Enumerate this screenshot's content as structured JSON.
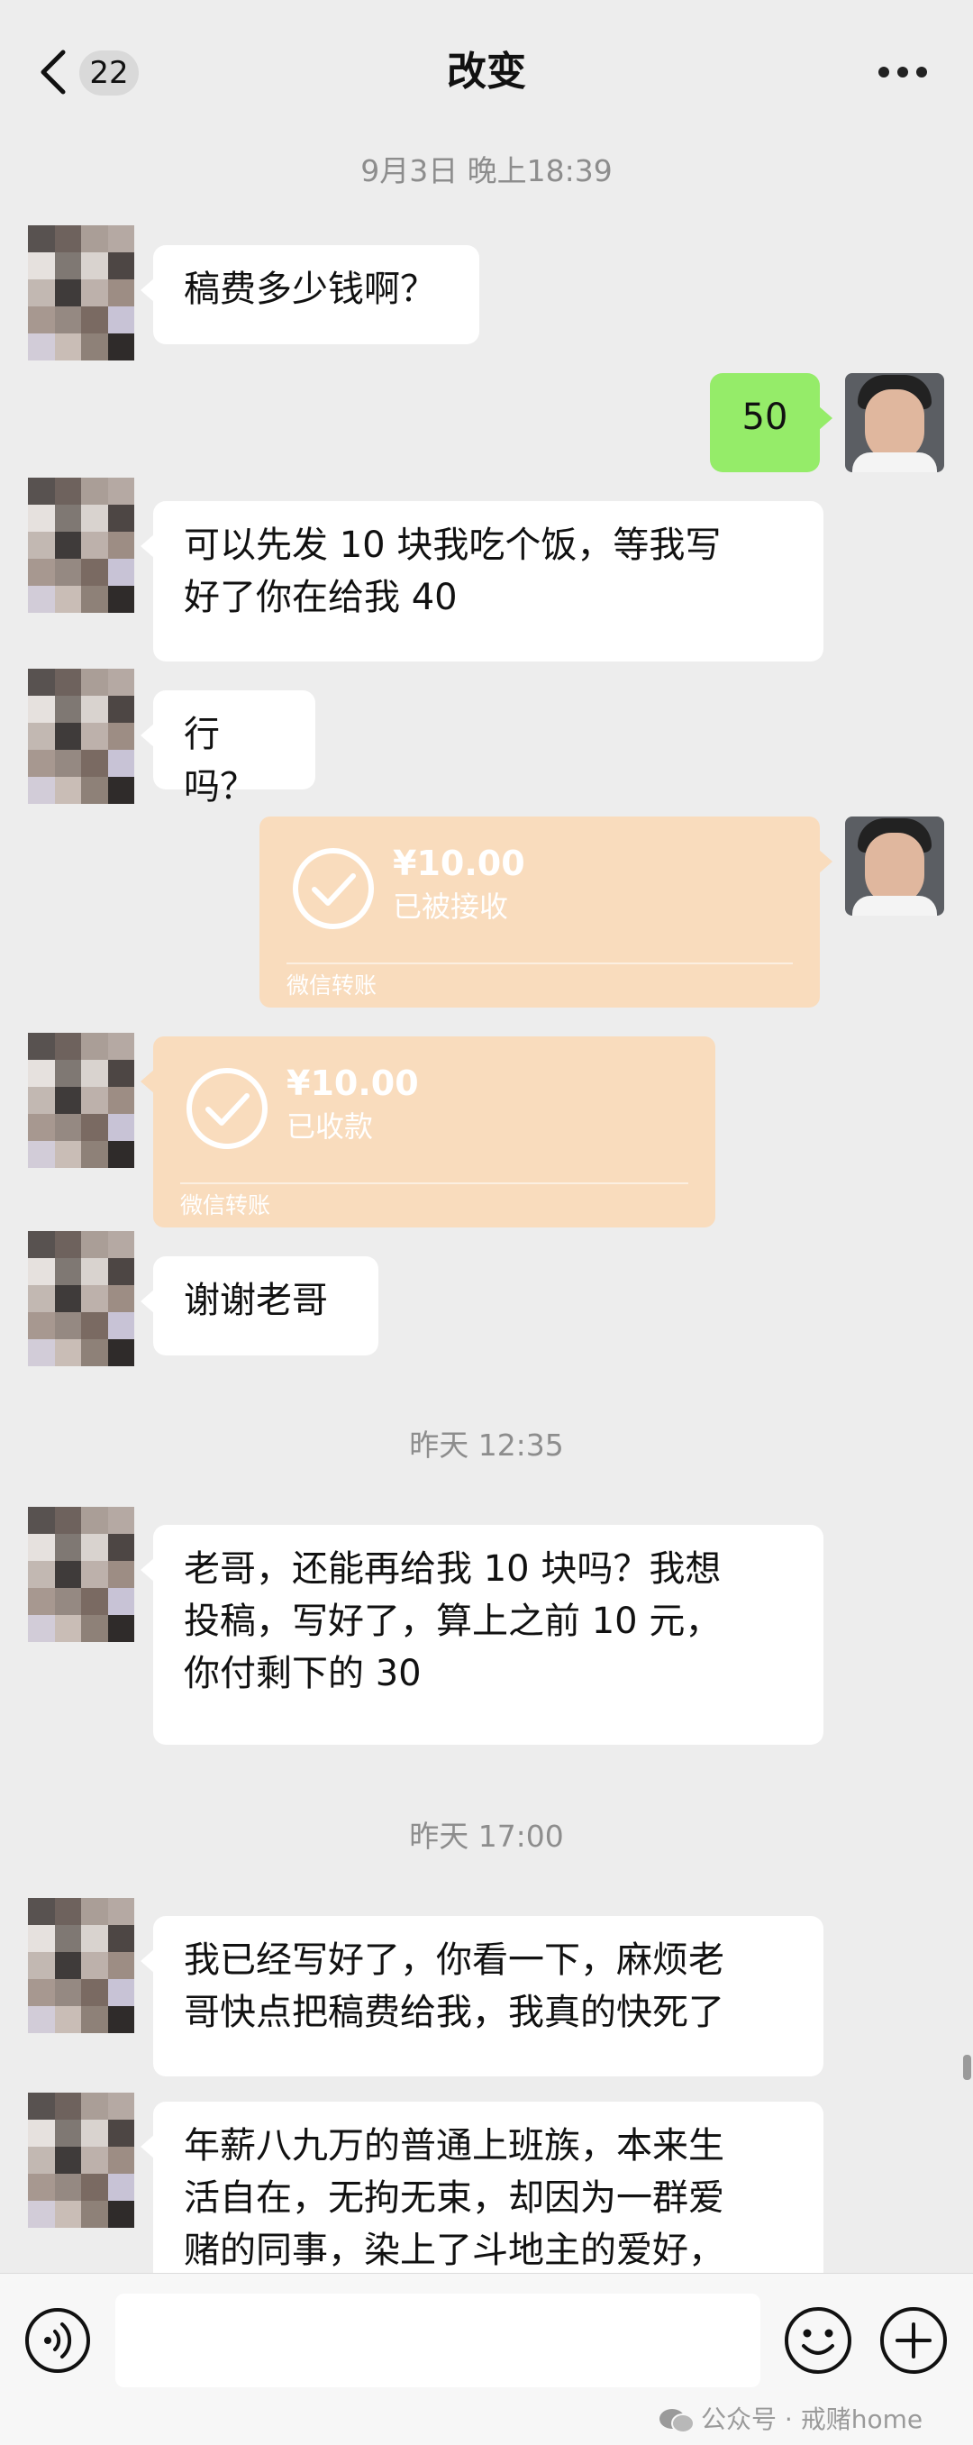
{
  "header": {
    "back_count": "22",
    "title": "改变"
  },
  "timestamps": [
    "9月3日 晚上18:39",
    "昨天 12:35",
    "昨天 17:00"
  ],
  "messages": [
    {
      "text": "稿费多少钱啊？"
    },
    {
      "text": "50"
    },
    {
      "text": "可以先发 10 块我吃个饭，等我写\n好了你在给我 40"
    },
    {
      "text": "行吗？"
    },
    {
      "amount": "¥10.00",
      "status": "已被接收",
      "footer": "微信转账"
    },
    {
      "amount": "¥10.00",
      "status": "已收款",
      "footer": "微信转账"
    },
    {
      "text": "谢谢老哥"
    },
    {
      "text": "老哥，还能再给我 10 块吗？我想\n投稿，写好了，算上之前 10 元，\n你付剩下的 30"
    },
    {
      "text": "我已经写好了，你看一下，麻烦老\n哥快点把稿费给我，我真的快死了"
    },
    {
      "text": "年薪八九万的普通上班族，本来生\n活自在，无拘无束，却因为一群爱\n赌的同事，染上了斗地主的爱好，"
    }
  ],
  "watermark": "公众号 · 戒赌home",
  "colors": {
    "background": "#ededed",
    "sent_bubble": "#95ec69",
    "transfer_card": "#f9dcbd"
  }
}
